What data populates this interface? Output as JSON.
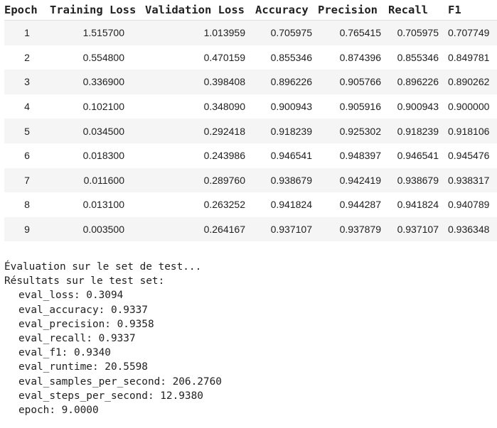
{
  "table": {
    "headers": [
      "Epoch",
      "Training Loss",
      "Validation Loss",
      "Accuracy",
      "Precision",
      "Recall",
      "F1"
    ],
    "rows": [
      [
        "1",
        "1.515700",
        "1.013959",
        "0.705975",
        "0.765415",
        "0.705975",
        "0.707749"
      ],
      [
        "2",
        "0.554800",
        "0.470159",
        "0.855346",
        "0.874396",
        "0.855346",
        "0.849781"
      ],
      [
        "3",
        "0.336900",
        "0.398408",
        "0.896226",
        "0.905766",
        "0.896226",
        "0.890262"
      ],
      [
        "4",
        "0.102100",
        "0.348090",
        "0.900943",
        "0.905916",
        "0.900943",
        "0.900000"
      ],
      [
        "5",
        "0.034500",
        "0.292418",
        "0.918239",
        "0.925302",
        "0.918239",
        "0.918106"
      ],
      [
        "6",
        "0.018300",
        "0.243986",
        "0.946541",
        "0.948397",
        "0.946541",
        "0.945476"
      ],
      [
        "7",
        "0.011600",
        "0.289760",
        "0.938679",
        "0.942419",
        "0.938679",
        "0.938317"
      ],
      [
        "8",
        "0.013100",
        "0.263252",
        "0.941824",
        "0.944287",
        "0.941824",
        "0.940789"
      ],
      [
        "9",
        "0.003500",
        "0.264167",
        "0.937107",
        "0.937879",
        "0.937107",
        "0.936348"
      ]
    ]
  },
  "console": {
    "line1": "Évaluation sur le set de test...",
    "line2": "Résultats sur le test set:",
    "metrics": [
      "eval_loss: 0.3094",
      "eval_accuracy: 0.9337",
      "eval_precision: 0.9358",
      "eval_recall: 0.9337",
      "eval_f1: 0.9340",
      "eval_runtime: 20.5598",
      "eval_samples_per_second: 206.2760",
      "eval_steps_per_second: 12.9380",
      "epoch: 9.0000"
    ]
  }
}
